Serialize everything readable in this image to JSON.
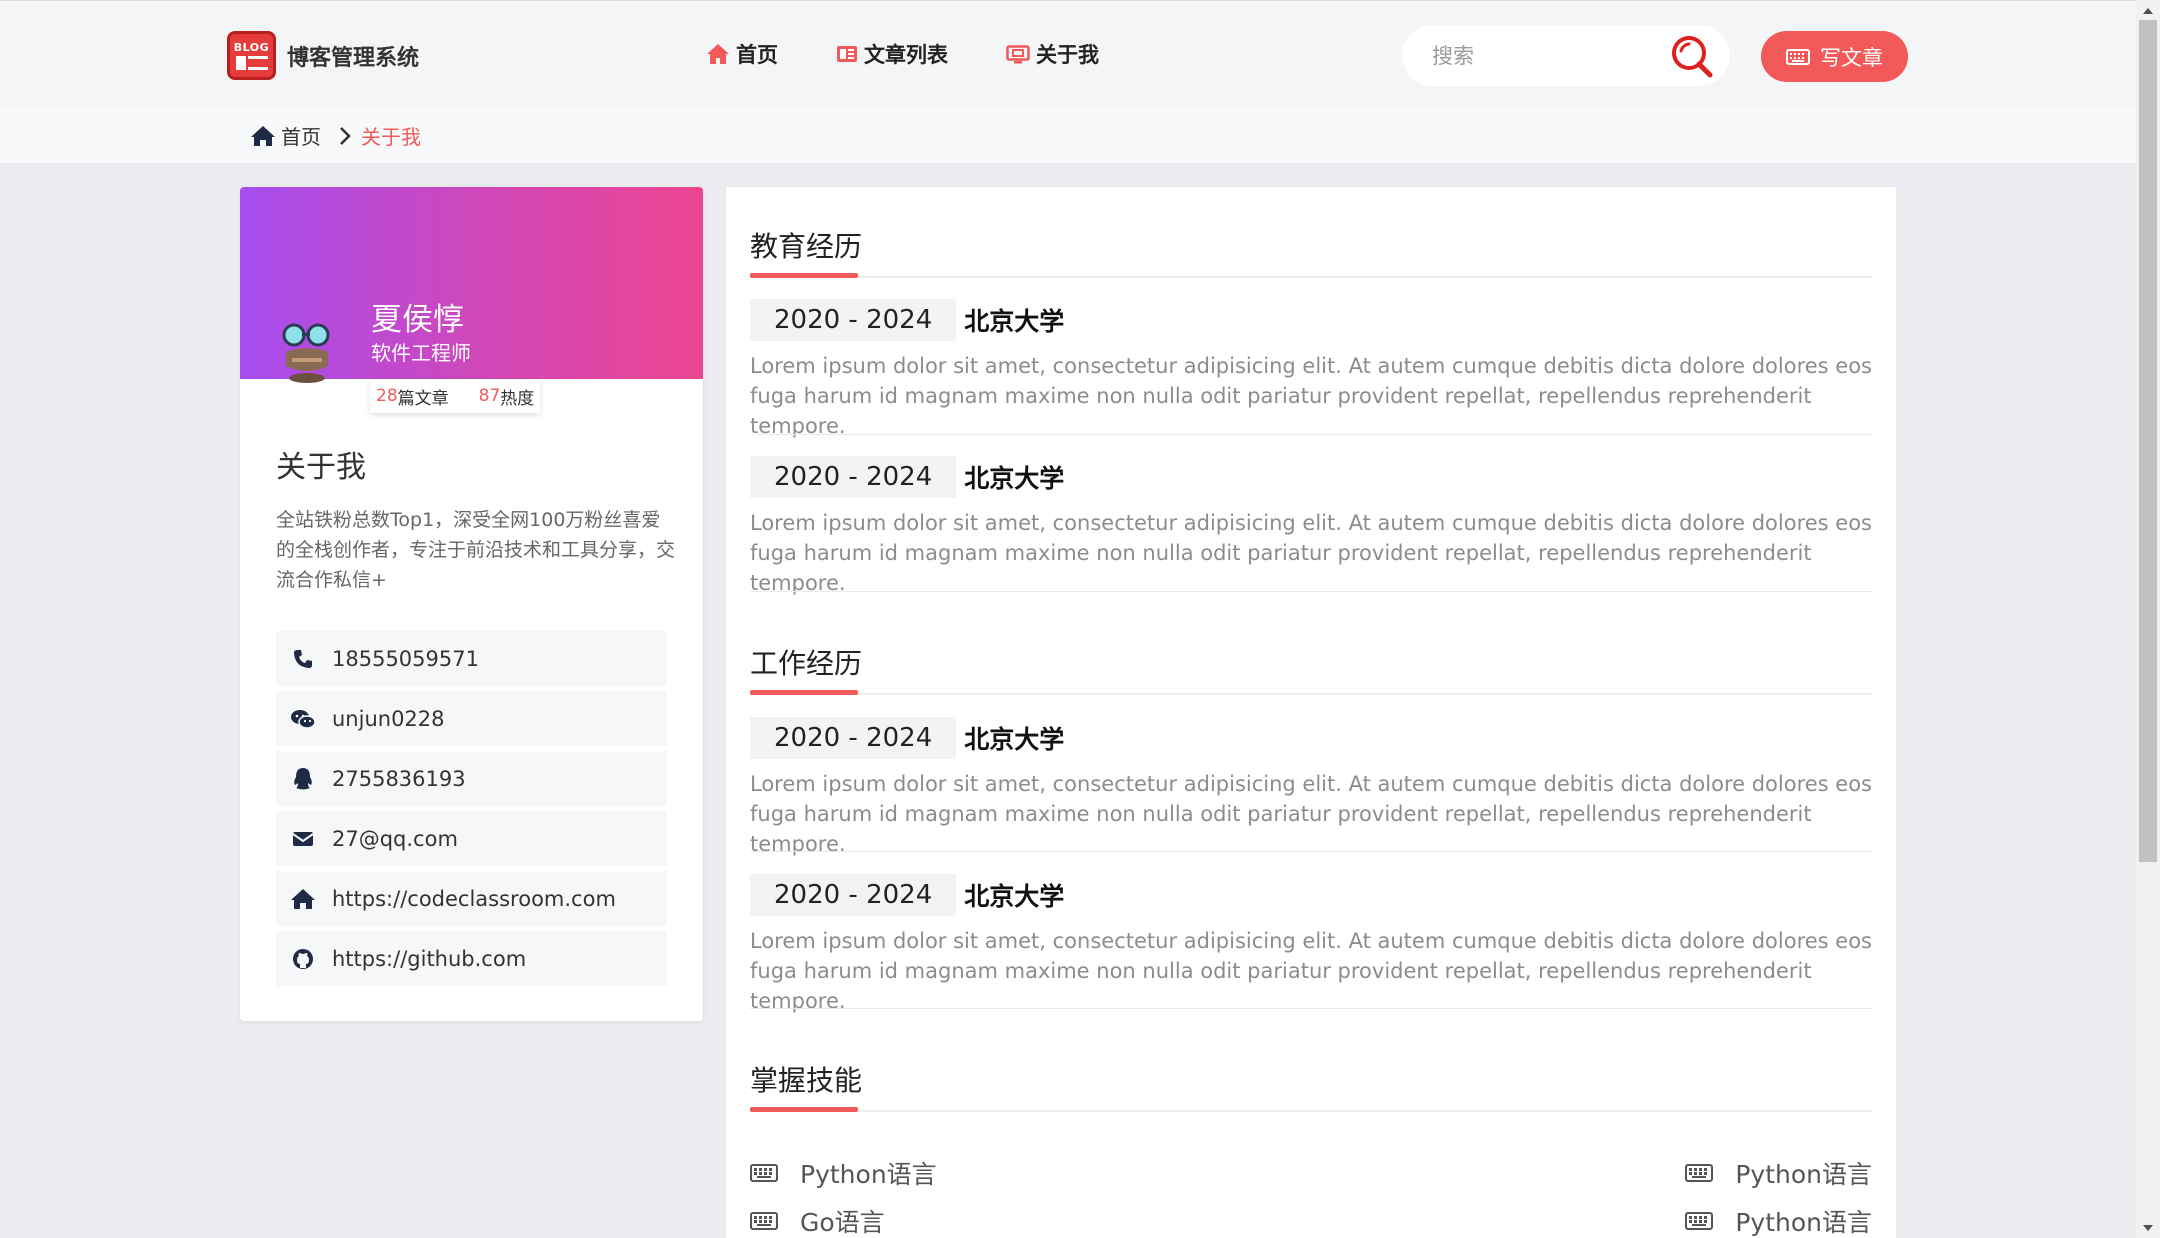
{
  "header": {
    "logo_text": "BLOG",
    "app_title": "博客管理系统",
    "nav": [
      {
        "label": "首页"
      },
      {
        "label": "文章列表"
      },
      {
        "label": "关于我"
      }
    ],
    "search_placeholder": "搜索",
    "write_label": "写文章",
    "accent_color": "#f25a5a"
  },
  "breadcrumb": {
    "home": "首页",
    "current": "关于我"
  },
  "profile": {
    "name": "夏侯惇",
    "role": "软件工程师",
    "articles_count": "28",
    "articles_label": "篇文章",
    "heat_count": "87",
    "heat_label": "热度",
    "about_title": "关于我",
    "about_text": "全站铁粉总数Top1，深受全网100万粉丝喜爱的全栈创作者，专注于前沿技术和工具分享，交流合作私信+",
    "contacts": [
      {
        "icon": "phone-icon",
        "value": "18555059571"
      },
      {
        "icon": "wechat-icon",
        "value": "unjun0228"
      },
      {
        "icon": "qq-icon",
        "value": "2755836193"
      },
      {
        "icon": "mail-icon",
        "value": "27@qq.com"
      },
      {
        "icon": "home-icon",
        "value": "https://codeclassroom.com"
      },
      {
        "icon": "github-icon",
        "value": "https://github.com"
      }
    ]
  },
  "resume": {
    "education_title": "教育经历",
    "education": [
      {
        "date": "2020 - 2024",
        "school": "北京大学",
        "desc": "Lorem ipsum dolor sit amet, consectetur adipisicing elit. At autem cumque debitis dicta dolore dolores eos fuga harum id magnam maxime non nulla odit pariatur provident repellat, repellendus reprehenderit tempore."
      },
      {
        "date": "2020 - 2024",
        "school": "北京大学",
        "desc": "Lorem ipsum dolor sit amet, consectetur adipisicing elit. At autem cumque debitis dicta dolore dolores eos fuga harum id magnam maxime non nulla odit pariatur provident repellat, repellendus reprehenderit tempore."
      }
    ],
    "work_title": "工作经历",
    "work": [
      {
        "date": "2020 - 2024",
        "school": "北京大学",
        "desc": "Lorem ipsum dolor sit amet, consectetur adipisicing elit. At autem cumque debitis dicta dolore dolores eos fuga harum id magnam maxime non nulla odit pariatur provident repellat, repellendus reprehenderit tempore."
      },
      {
        "date": "2020 - 2024",
        "school": "北京大学",
        "desc": "Lorem ipsum dolor sit amet, consectetur adipisicing elit. At autem cumque debitis dicta dolore dolores eos fuga harum id magnam maxime non nulla odit pariatur provident repellat, repellendus reprehenderit tempore."
      }
    ],
    "skills_title": "掌握技能",
    "skills": [
      {
        "label": "Python语言"
      },
      {
        "label": "Python语言"
      },
      {
        "label": "Go语言"
      },
      {
        "label": "Python语言"
      }
    ]
  }
}
